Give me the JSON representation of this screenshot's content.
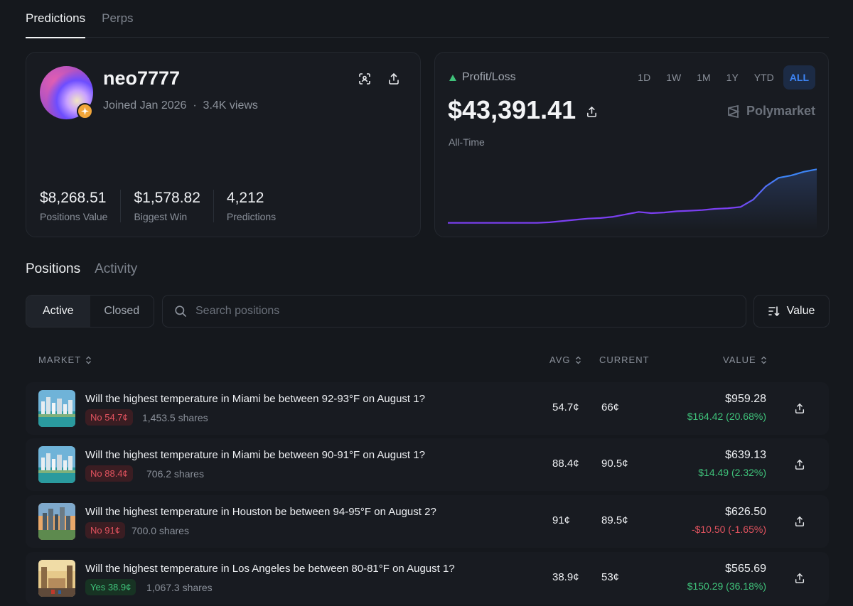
{
  "top_tabs": [
    {
      "label": "Predictions"
    },
    {
      "label": "Perps"
    }
  ],
  "profile": {
    "username": "neo7777",
    "joined": "Joined Jan 2026",
    "separator": "·",
    "views": "3.4K views",
    "stats": [
      {
        "value": "$8,268.51",
        "label": "Positions Value"
      },
      {
        "value": "$1,578.82",
        "label": "Biggest Win"
      },
      {
        "value": "4,212",
        "label": "Predictions"
      }
    ]
  },
  "pnl": {
    "title": "Profit/Loss",
    "value": "$43,391.41",
    "period": "All-Time",
    "brand": "Polymarket",
    "ranges": [
      "1D",
      "1W",
      "1M",
      "1Y",
      "YTD",
      "ALL"
    ],
    "active_range": "ALL",
    "line_color_start": "#7b3ff2",
    "line_color_end": "#3d84f5"
  },
  "chart_data": {
    "type": "line",
    "title": "Profit/Loss",
    "xlabel": "",
    "ylabel": "",
    "series": [
      {
        "values": [
          0.12,
          0.12,
          0.12,
          0.12,
          0.12,
          0.12,
          0.12,
          0.12,
          0.13,
          0.15,
          0.17,
          0.19,
          0.2,
          0.22,
          0.26,
          0.3,
          0.28,
          0.29,
          0.31,
          0.32,
          0.33,
          0.35,
          0.36,
          0.38,
          0.5,
          0.72,
          0.86,
          0.9,
          0.96,
          1.0
        ]
      }
    ],
    "ylim": [
      0,
      1.05
    ]
  },
  "section_tabs": [
    {
      "label": "Positions"
    },
    {
      "label": "Activity"
    }
  ],
  "filters": {
    "active": "Active",
    "closed": "Closed"
  },
  "search": {
    "placeholder": "Search positions"
  },
  "sort": {
    "label": "Value"
  },
  "columns": {
    "market": "MARKET",
    "avg": "AVG",
    "current": "CURRENT",
    "value": "VALUE"
  },
  "positions": [
    {
      "question": "Will the highest temperature in Miami be between 92-93°F on August 1?",
      "outcome": "No 54.7¢",
      "side": "no",
      "shares": "1,453.5 shares",
      "avg": "54.7¢",
      "current": "66¢",
      "value": "$959.28",
      "change": "$164.42 (20.68%)",
      "direction": "pos",
      "thumb": "miami"
    },
    {
      "question": "Will the highest temperature in Miami be between 90-91°F on August 1?",
      "outcome": "No 88.4¢",
      "side": "no",
      "shares": "706.2 shares",
      "avg": "88.4¢",
      "current": "90.5¢",
      "value": "$639.13",
      "change": "$14.49 (2.32%)",
      "direction": "pos",
      "thumb": "miami"
    },
    {
      "question": "Will the highest temperature in Houston be between 94-95°F on August 2?",
      "outcome": "No 91¢",
      "side": "no",
      "shares": "700.0 shares",
      "avg": "91¢",
      "current": "89.5¢",
      "value": "$626.50",
      "change": "-$10.50 (-1.65%)",
      "direction": "neg",
      "thumb": "houston"
    },
    {
      "question": "Will the highest temperature in Los Angeles be between 80-81°F on August 1?",
      "outcome": "Yes 38.9¢",
      "side": "yes",
      "shares": "1,067.3 shares",
      "avg": "38.9¢",
      "current": "53¢",
      "value": "$565.69",
      "change": "$150.29 (36.18%)",
      "direction": "pos",
      "thumb": "la"
    }
  ]
}
